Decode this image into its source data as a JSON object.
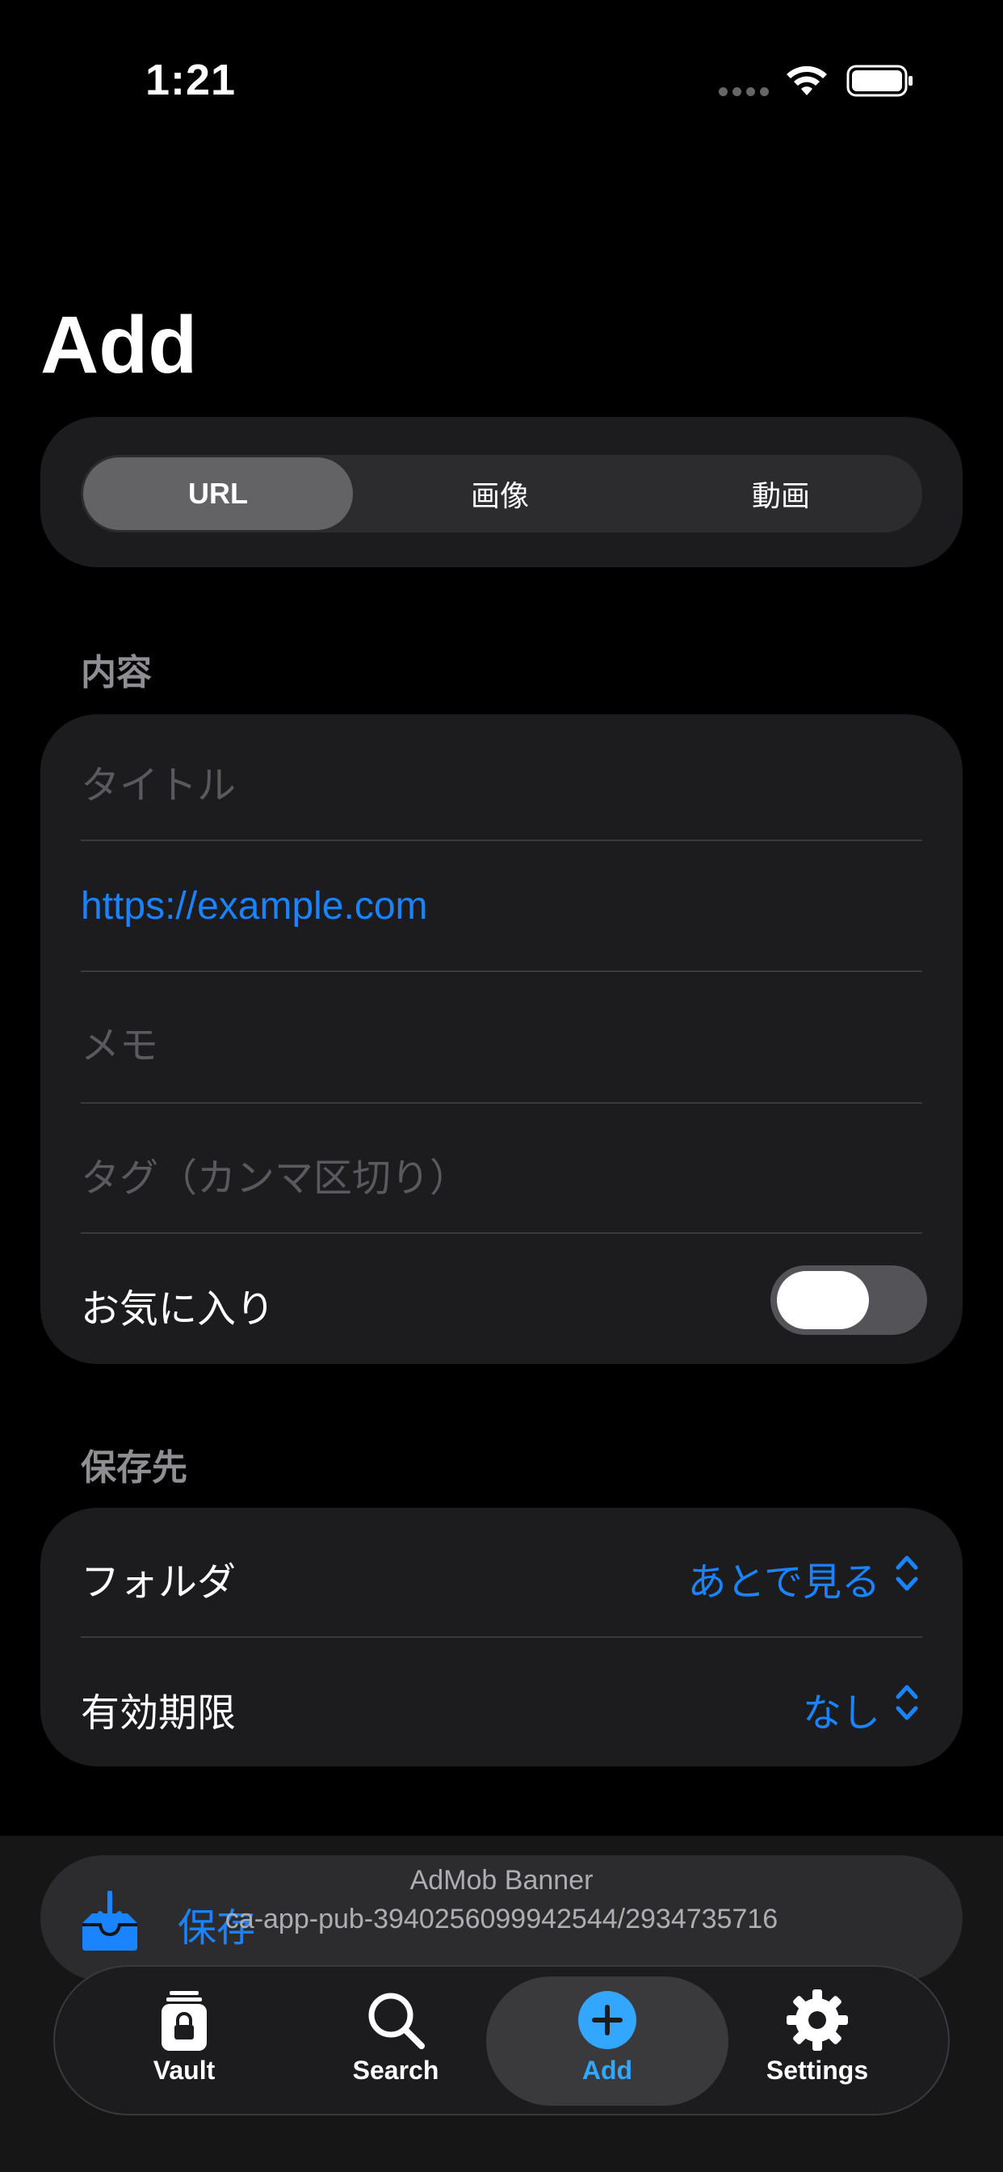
{
  "status_bar": {
    "time": "1:21"
  },
  "page": {
    "title": "Add"
  },
  "segments": [
    {
      "label": "URL",
      "selected": true
    },
    {
      "label": "画像",
      "selected": false
    },
    {
      "label": "動画",
      "selected": false
    }
  ],
  "content_section": {
    "header": "内容",
    "title_placeholder": "タイトル",
    "url_value": "https://example.com",
    "memo_placeholder": "メモ",
    "tags_placeholder": "タグ（カンマ区切り）",
    "favorite_label": "お気に入り",
    "favorite_on": false
  },
  "destination_section": {
    "header": "保存先",
    "folder_label": "フォルダ",
    "folder_value": "あとで見る",
    "expiry_label": "有効期限",
    "expiry_value": "なし"
  },
  "save_button": {
    "label": "保存"
  },
  "ad_banner": {
    "title": "AdMob Banner",
    "unit_id": "ca-app-pub-3940256099942544/2934735716"
  },
  "tabs": [
    {
      "label": "Vault",
      "icon": "lock-icon",
      "active": false
    },
    {
      "label": "Search",
      "icon": "search-icon",
      "active": false
    },
    {
      "label": "Add",
      "icon": "plus-circle-icon",
      "active": true
    },
    {
      "label": "Settings",
      "icon": "gear-icon",
      "active": false
    }
  ],
  "colors": {
    "accent": "#1a84ff",
    "tab_accent": "#33a6ff",
    "background": "#000000",
    "card": "#1c1c1e"
  }
}
